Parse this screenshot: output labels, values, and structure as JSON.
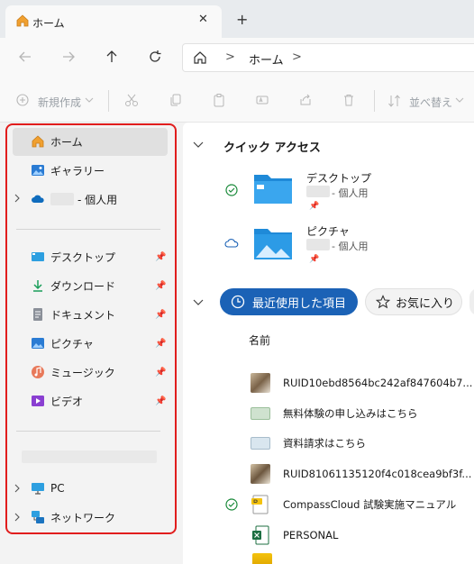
{
  "tab": {
    "title": "ホーム",
    "close": "✕",
    "new_tab": "+"
  },
  "address": {
    "home_sep": ">",
    "crumb": "ホーム",
    "end_chevron": ">"
  },
  "command_bar": {
    "new_label": "新規作成",
    "sort_label": "並べ替え"
  },
  "sidebar": {
    "home": "ホーム",
    "gallery": "ギャラリー",
    "onedrive": "- 個人用",
    "quick": [
      {
        "label": "デスクトップ",
        "icon": "desktop-icon"
      },
      {
        "label": "ダウンロード",
        "icon": "download-icon"
      },
      {
        "label": "ドキュメント",
        "icon": "document-icon"
      },
      {
        "label": "ピクチャ",
        "icon": "pictures-icon"
      },
      {
        "label": "ミュージック",
        "icon": "music-icon"
      },
      {
        "label": "ビデオ",
        "icon": "video-icon"
      }
    ],
    "pc": "PC",
    "network": "ネットワーク"
  },
  "main": {
    "quick_access_title": "クイック アクセス",
    "folders": [
      {
        "name": "デスクトップ",
        "sub": "- 個人用"
      },
      {
        "name": "ピクチャ",
        "sub": "- 個人用"
      }
    ],
    "recent_pill": "最近使用した項目",
    "favorites_pill": "お気に入り",
    "column_name": "名前",
    "files": [
      "RUID10ebd8564bc242af847604b7...",
      "無料体験の申し込みはこちら",
      "資料請求はこちら",
      "RUID81061135120f4c018cea9bf3f...",
      "CompassCloud 試験実施マニュアル",
      "PERSONAL"
    ]
  },
  "colors": {
    "accent": "#1b62b6",
    "highlight_outline": "#e11d1d"
  }
}
